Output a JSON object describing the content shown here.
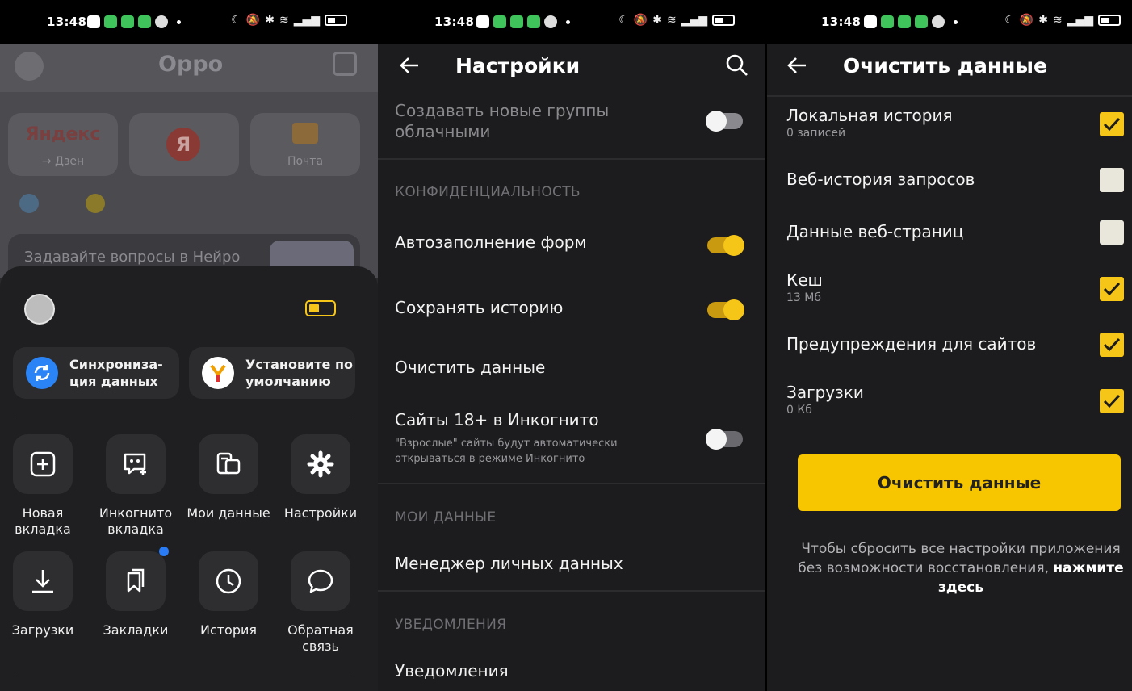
{
  "status": {
    "time": "13:48"
  },
  "menu": {
    "home_title": "Oppo",
    "tiles": [
      {
        "label": "→ Дзен",
        "logo": "Яндекс"
      },
      {
        "label": "",
        "logo": "Я"
      },
      {
        "label": "Почта",
        "logo": ""
      }
    ],
    "neuro_prompt": "Задавайте вопросы в Нейро",
    "sync_label": "Синхрониза-ция данных",
    "default_label": "Установите по умолчанию",
    "items": [
      {
        "label": "Новая вкладка",
        "icon": "plus-square-icon"
      },
      {
        "label": "Инкогнито вкладка",
        "icon": "incognito-icon"
      },
      {
        "label": "Мои данные",
        "icon": "my-data-icon"
      },
      {
        "label": "Настройки",
        "icon": "gear-icon"
      },
      {
        "label": "Загрузки",
        "icon": "download-icon"
      },
      {
        "label": "Закладки",
        "icon": "bookmarks-icon"
      },
      {
        "label": "История",
        "icon": "clock-icon"
      },
      {
        "label": "Обратная связь",
        "icon": "chat-bubble-icon"
      }
    ]
  },
  "settings": {
    "title": "Настройки",
    "cloud_groups": "Создавать новые группы облачными",
    "section_privacy": "КОНФИДЕНЦИАЛЬНОСТЬ",
    "autofill": "Автозаполнение форм",
    "save_history": "Сохранять историю",
    "clear_data": "Очистить данные",
    "sites18": "Сайты 18+ в Инкогнито",
    "sites18_sub": "\"Взрослые\" сайты будут автоматически открываться в режиме Инкогнито",
    "section_my_data": "МОИ ДАННЫЕ",
    "personal_manager": "Менеджер личных данных",
    "section_notifications": "УВЕДОМЛЕНИЯ",
    "notifications": "Уведомления",
    "toggles": {
      "cloud_groups": false,
      "autofill": true,
      "save_history": true,
      "sites18": false
    }
  },
  "clear": {
    "title": "Очистить данные",
    "items": [
      {
        "title": "Локальная история",
        "sub": "0 записей",
        "checked": true
      },
      {
        "title": "Веб-история запросов",
        "sub": "",
        "checked": false
      },
      {
        "title": "Данные веб-страниц",
        "sub": "",
        "checked": false
      },
      {
        "title": "Кеш",
        "sub": "13 Мб",
        "checked": true
      },
      {
        "title": "Предупреждения для сайтов",
        "sub": "",
        "checked": true
      },
      {
        "title": "Загрузки",
        "sub": "0 Кб",
        "checked": true
      }
    ],
    "button": "Очистить данные",
    "note": "Чтобы сбросить все настройки приложения без возможности восстановления,",
    "note_link": "нажмите здесь"
  },
  "colors": {
    "accent": "#f5c518",
    "panel_bg": "#1c1c1e",
    "toggle_off_track": "#6a6a6e"
  }
}
